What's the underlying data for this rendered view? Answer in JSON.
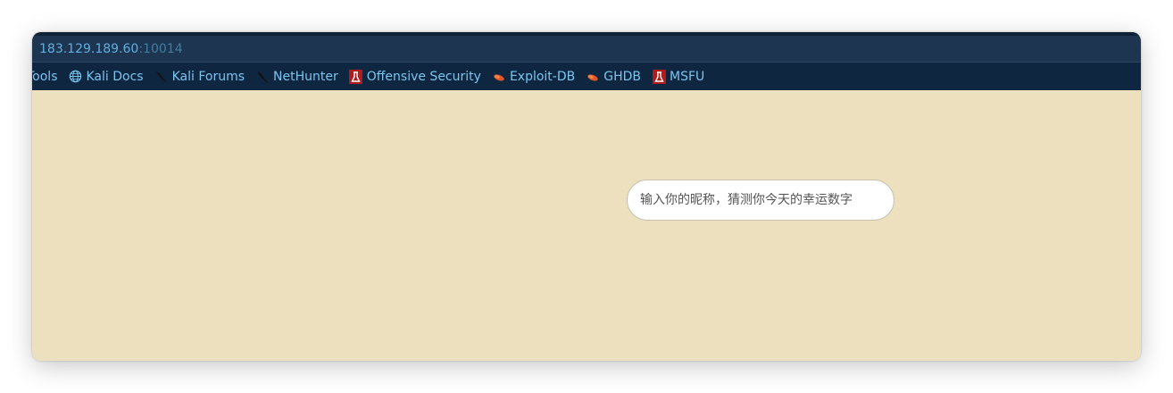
{
  "browser": {
    "url_host": "183.129.189.60",
    "url_port": ":10014"
  },
  "bookmarks": [
    {
      "label": "Tools",
      "icon": "none"
    },
    {
      "label": "Kali Docs",
      "icon": "globe-icon"
    },
    {
      "label": "Kali Forums",
      "icon": "kali-dragon-icon"
    },
    {
      "label": "NetHunter",
      "icon": "kali-dragon-icon"
    },
    {
      "label": "Offensive Security",
      "icon": "offsec-icon"
    },
    {
      "label": "Exploit-DB",
      "icon": "exploitdb-bug-icon"
    },
    {
      "label": "GHDB",
      "icon": "exploitdb-bug-icon"
    },
    {
      "label": "MSFU",
      "icon": "offsec-icon"
    }
  ],
  "page": {
    "nickname_placeholder": "输入你的昵称，猜测你今天的幸运数字",
    "nickname_value": ""
  },
  "colors": {
    "page_background": "#ece0bf",
    "bookmark_bar": "#0f2640",
    "url_bar": "#1d3550",
    "link_text": "#7cc4ee"
  }
}
